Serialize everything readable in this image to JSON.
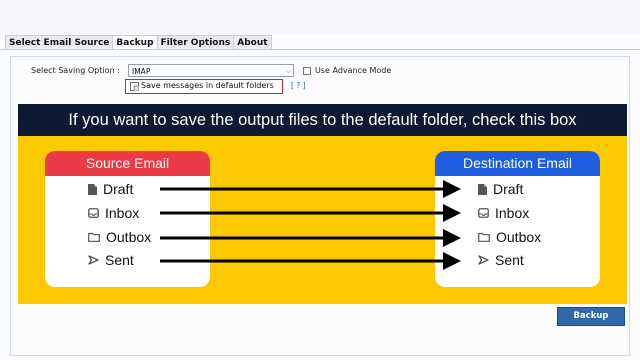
{
  "tabs": [
    "Select Email Source",
    "Backup",
    "Filter Options",
    "About"
  ],
  "active_tab": "Backup",
  "saving": {
    "label": "Select Saving Option :",
    "value": "IMAP",
    "advance_label": "Use Advance Mode",
    "advance_checked": false,
    "save_default_label": "Save messages in default folders",
    "save_default_checked": false,
    "help": "[ ? ]"
  },
  "banner": "If you want to save the output files to the default folder, check this box",
  "source": {
    "title": "Source Email",
    "folders": [
      "Draft",
      "Inbox",
      "Outbox",
      "Sent"
    ]
  },
  "destination": {
    "title": "Destination Email",
    "folders": [
      "Draft",
      "Inbox",
      "Outbox",
      "Sent"
    ]
  },
  "folder_icons": [
    "document-icon",
    "inbox-icon",
    "folder-icon",
    "send-icon"
  ],
  "colors": {
    "banner_bg": "#0c1b33",
    "highlight_bg": "#fcc800",
    "source_header": "#ec3a46",
    "destination_header": "#1f5ee0",
    "callout_border": "#c0282d",
    "button_bg": "#2f67a8"
  },
  "buttons": {
    "backup": "Backup"
  }
}
